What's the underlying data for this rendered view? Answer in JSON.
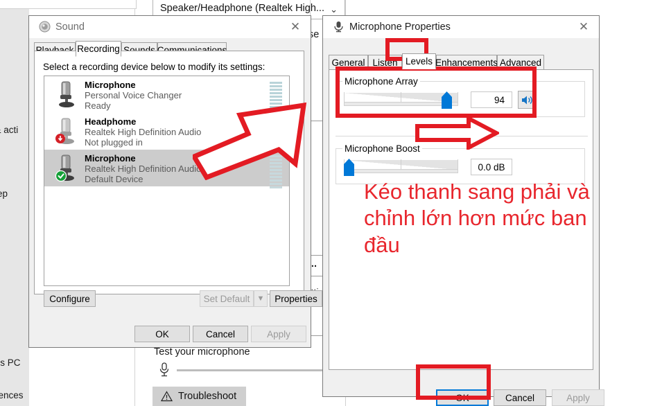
{
  "settings_app": {
    "sidebar_fragments": [
      "s & acti",
      "ep",
      " this PC",
      "riences"
    ],
    "device_combo": {
      "value": "Speaker/Headphone (Realtek High...",
      "chevron": "chevron-down-icon"
    },
    "fragments_right": [
      "t se",
      "io...",
      "setti"
    ],
    "test_microphone_label": "Test your microphone",
    "troubleshoot_label": "Troubleshoot",
    "troubleshoot_icon": "warning-triangle-icon"
  },
  "sound_dialog": {
    "title": "Sound",
    "title_icon": "sound-speaker-icon",
    "close_icon": "close-icon",
    "tabs": [
      {
        "label": "Playback",
        "active": false
      },
      {
        "label": "Recording",
        "active": true
      },
      {
        "label": "Sounds",
        "active": false
      },
      {
        "label": "Communications",
        "active": false
      }
    ],
    "hint": "Select a recording device below to modify its settings:",
    "devices": [
      {
        "name": "Microphone",
        "desc": "Personal Voice Changer",
        "status": "Ready",
        "selected": false,
        "badge": "none",
        "meter": "active"
      },
      {
        "name": "Headphome",
        "desc": "Realtek High Definition Audio",
        "status": "Not plugged in",
        "selected": false,
        "badge": "unplugged-icon",
        "meter": "none"
      },
      {
        "name": "Microphone",
        "desc": "Realtek High Definition Audio",
        "status": "Default Device",
        "selected": true,
        "badge": "default-check-icon",
        "meter": "active"
      }
    ],
    "configure_label": "Configure",
    "set_default_label": "Set Default",
    "set_default_chevron": "chevron-down-icon",
    "properties_label": "Properties",
    "ok_label": "OK",
    "cancel_label": "Cancel",
    "apply_label": "Apply"
  },
  "mic_dialog": {
    "title": "Microphone Properties",
    "title_icon": "microphone-icon",
    "close_icon": "close-icon",
    "tabs": [
      {
        "label": "General",
        "active": false
      },
      {
        "label": "Listen",
        "active": false
      },
      {
        "label": "Levels",
        "active": true
      },
      {
        "label": "Enhancements",
        "active": false
      },
      {
        "label": "Advanced",
        "active": false
      }
    ],
    "mic_array": {
      "label": "Microphone Array",
      "value": "94",
      "slider_percent": 94,
      "mute_icon": "speaker-on-icon"
    },
    "mic_boost": {
      "label": "Microphone Boost",
      "value": "0.0 dB",
      "slider_percent": 0
    },
    "ok_label": "OK",
    "cancel_label": "Cancel",
    "apply_label": "Apply"
  },
  "annotation": {
    "text": "Kéo thanh sang phải và chỉnh lớn hơn mức ban đầu",
    "color": "#e8262d",
    "highlight_color": "#e31b23",
    "arrow_up_right": "red-arrow-up-right-icon",
    "arrow_right": "red-arrow-right-icon",
    "box_levels_tab": "red-highlight-box",
    "box_mic_array": "red-highlight-box",
    "box_ok_button": "red-highlight-box"
  }
}
